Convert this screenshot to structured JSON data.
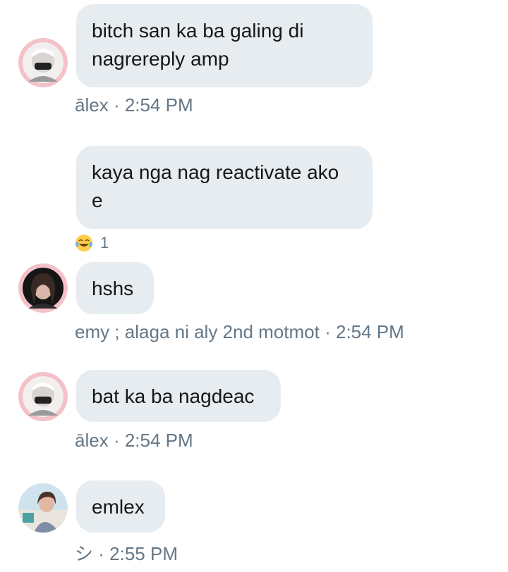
{
  "messages": [
    {
      "text": "bitch san ka ba galing di\nnagrereply amp",
      "sender_name": "ālex",
      "time": "2:54 PM",
      "avatar": "alex-avatar"
    },
    {
      "text": "kaya nga nag reactivate ako\ne",
      "reaction": {
        "emoji": "face-with-tears-of-joy-icon",
        "count": "1"
      }
    },
    {
      "text": "hshs",
      "sender_name": "emy ; alaga ni aly 2nd motmot",
      "time": "2:54 PM",
      "avatar": "emy-avatar"
    },
    {
      "text": "bat ka ba nagdeac",
      "sender_name": "ālex",
      "time": "2:54 PM",
      "avatar": "alex-avatar"
    },
    {
      "text": "emlex",
      "sender_name": "シ",
      "time": "2:55 PM",
      "avatar": "user-avatar"
    }
  ],
  "separator": "·",
  "colors": {
    "bubble": "#e6ecf0",
    "text": "#14171a",
    "meta": "#657786",
    "avatar_ring": "#f3c1c7"
  }
}
